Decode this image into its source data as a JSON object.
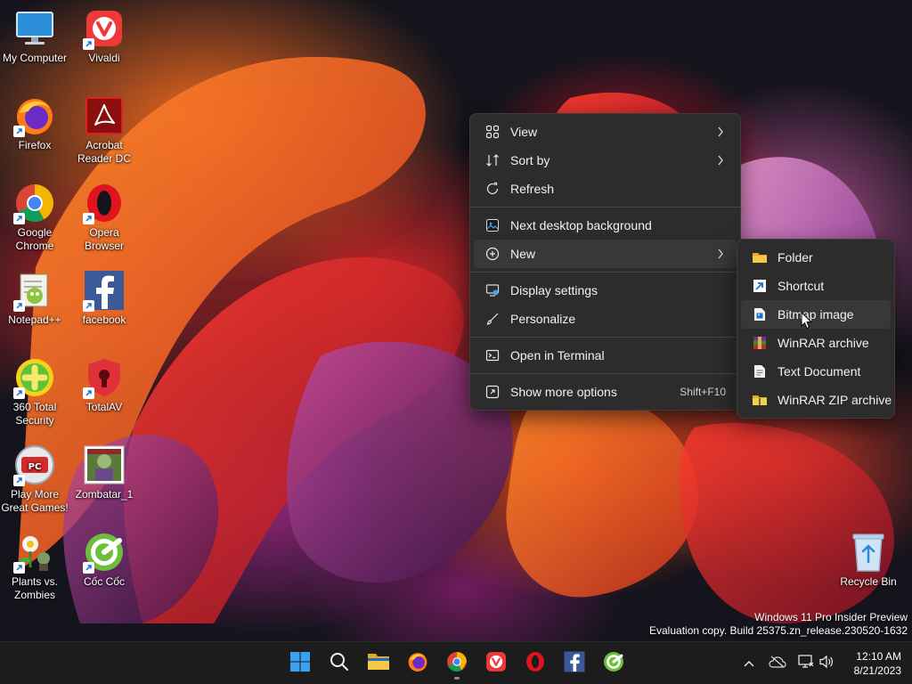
{
  "desktop": {
    "icons": [
      {
        "label": "My Computer"
      },
      {
        "label": "Vivaldi"
      },
      {
        "label": "Firefox"
      },
      {
        "label": "Acrobat Reader DC"
      },
      {
        "label": "Google Chrome"
      },
      {
        "label": "Opera Browser"
      },
      {
        "label": "Notepad++"
      },
      {
        "label": "facebook"
      },
      {
        "label": "360 Total Security"
      },
      {
        "label": "TotalAV"
      },
      {
        "label": "Play More Great Games!"
      },
      {
        "label": "Zombatar_1"
      },
      {
        "label": "Plants vs. Zombies"
      },
      {
        "label": "Cốc Cốc"
      },
      {
        "label": "Recycle Bin"
      }
    ]
  },
  "context_menu": {
    "items": [
      {
        "label": "View",
        "icon": "grid-icon",
        "submenu": true
      },
      {
        "label": "Sort by",
        "icon": "sort-icon",
        "submenu": true
      },
      {
        "label": "Refresh",
        "icon": "refresh-icon"
      },
      {
        "label": "Next desktop background",
        "icon": "next-background-icon"
      },
      {
        "label": "New",
        "icon": "new-plus-icon",
        "submenu": true,
        "highlighted": true
      },
      {
        "label": "Display settings",
        "icon": "display-icon"
      },
      {
        "label": "Personalize",
        "icon": "brush-icon"
      },
      {
        "label": "Open in Terminal",
        "icon": "terminal-icon"
      },
      {
        "label": "Show more options",
        "icon": "more-options-icon",
        "shortcut": "Shift+F10"
      }
    ]
  },
  "new_submenu": {
    "items": [
      {
        "label": "Folder",
        "icon": "folder-icon"
      },
      {
        "label": "Shortcut",
        "icon": "shortcut-icon"
      },
      {
        "label": "Bitmap image",
        "icon": "bitmap-icon",
        "highlighted": true
      },
      {
        "label": "WinRAR archive",
        "icon": "winrar-icon"
      },
      {
        "label": "Text Document",
        "icon": "text-document-icon"
      },
      {
        "label": "WinRAR ZIP archive",
        "icon": "winrar-zip-icon"
      }
    ]
  },
  "watermark": {
    "line1": "Windows 11 Pro Insider Preview",
    "line2": "Evaluation copy. Build 25375.zn_release.230520-1632"
  },
  "taskbar": {
    "apps": [
      "start",
      "search",
      "file-explorer",
      "firefox",
      "chrome",
      "vivaldi",
      "opera",
      "facebook",
      "coc-coc"
    ]
  },
  "clock": {
    "time": "12:10 AM",
    "date": "8/21/2023"
  },
  "colors": {
    "menu_bg": "#2c2c2c",
    "menu_highlight": "#383838",
    "taskbar_bg": "#1c1c1c",
    "folder_yellow": "#f3c244",
    "start_blue": "#3aa0f0"
  }
}
